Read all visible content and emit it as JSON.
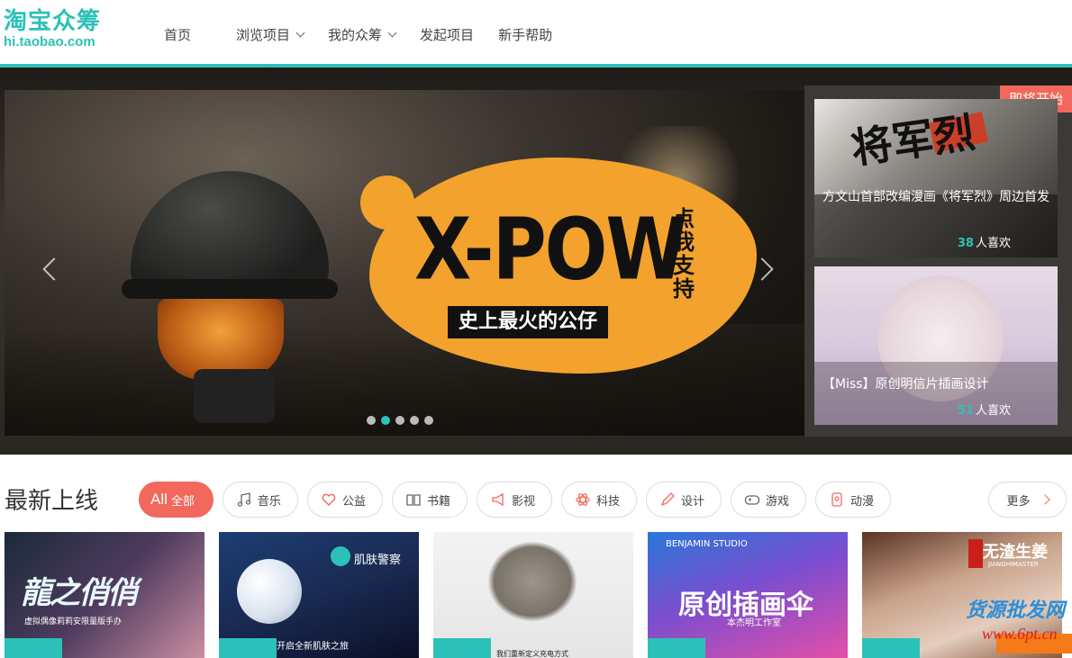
{
  "header": {
    "logo_main": "淘宝众筹",
    "logo_sub": "hi.taobao.com",
    "nav": [
      {
        "label": "首页",
        "dropdown": false
      },
      {
        "label": "浏览项目",
        "dropdown": true
      },
      {
        "label": "我的众筹",
        "dropdown": true
      },
      {
        "label": "发起项目",
        "dropdown": false
      },
      {
        "label": "新手帮助",
        "dropdown": false
      }
    ]
  },
  "hero": {
    "banner": {
      "headline": "X-POW",
      "vertical_text": "点我支持",
      "tagline": "史上最火的公仔",
      "dots": 5,
      "active_dot": 2
    },
    "side_badge": "即将开始",
    "cards": [
      {
        "title": "方文山首部改编漫画《将军烈》周边首发",
        "likes": "38",
        "likes_suffix": "人喜欢",
        "art_text": "将军烈"
      },
      {
        "title": "【Miss】原创明信片插画设计",
        "likes": "51",
        "likes_suffix": "人喜欢"
      }
    ]
  },
  "latest": {
    "title": "最新上线",
    "filters": [
      {
        "label": "全部",
        "prefix": "All",
        "icon": "all-icon",
        "active": true
      },
      {
        "label": "音乐",
        "icon": "music-icon",
        "active": false
      },
      {
        "label": "公益",
        "icon": "heart-icon",
        "active": false
      },
      {
        "label": "书籍",
        "icon": "book-icon",
        "active": false
      },
      {
        "label": "影视",
        "icon": "megaphone-icon",
        "active": false
      },
      {
        "label": "科技",
        "icon": "atom-icon",
        "active": false
      },
      {
        "label": "设计",
        "icon": "pencil-icon",
        "active": false
      },
      {
        "label": "游戏",
        "icon": "gamepad-icon",
        "active": false
      },
      {
        "label": "动漫",
        "icon": "badge-icon",
        "active": false
      }
    ],
    "more_label": "更多",
    "thumbs": [
      {
        "art_title": "龍之俏俏",
        "sub": "虚拟偶像莉莉安限量版手办"
      },
      {
        "brand": "肌肤警察",
        "sub": "开启全新肌肤之旅"
      },
      {
        "sub": "我们重新定义充电方式"
      },
      {
        "brand": "BENJAMIN STUDIO",
        "art_title": "原创插画伞",
        "sub": "本杰明工作室"
      },
      {
        "art_title": "无渣生姜",
        "sub": "JIANGHIMASTER"
      }
    ]
  },
  "watermark": {
    "text": "货源批发网",
    "url": "www.6pt.cn"
  },
  "colors": {
    "accent": "#2cc1b8",
    "primary": "#f3685d"
  }
}
